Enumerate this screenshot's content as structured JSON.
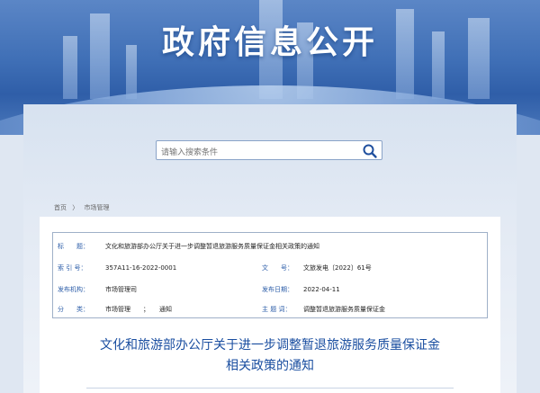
{
  "banner": {
    "title": "政府信息公开"
  },
  "search": {
    "placeholder": "请输入搜索条件"
  },
  "breadcrumb": {
    "home": "首页",
    "separator": "〉",
    "current": "市场管理"
  },
  "meta": {
    "title_label": "标　　题：",
    "title_value": "文化和旅游部办公厅关于进一步调整暂退旅游服务质量保证金相关政策的通知",
    "index_label": "索 引 号：",
    "index_value": "357A11-16-2022-0001",
    "docno_label": "文　　号：",
    "docno_value": "文旅发电〔2022〕61号",
    "issuer_label": "发布机构：",
    "issuer_value": "市场管理司",
    "date_label": "发布日期：",
    "date_value": "2022-04-11",
    "category_label": "分　　类：",
    "category_value_1": "市场管理",
    "category_sep": "；",
    "category_value_2": "通知",
    "keywords_label": "主 题 词：",
    "keywords_value": "调整暂退旅游服务质量保证金"
  },
  "document": {
    "title_line1": "文化和旅游部办公厅关于进一步调整暂退旅游服务质量保证金",
    "title_line2": "相关政策的通知"
  },
  "colors": {
    "accent": "#2b5ca8",
    "title": "#1a4ea0",
    "banner": "#3f6fb6"
  }
}
